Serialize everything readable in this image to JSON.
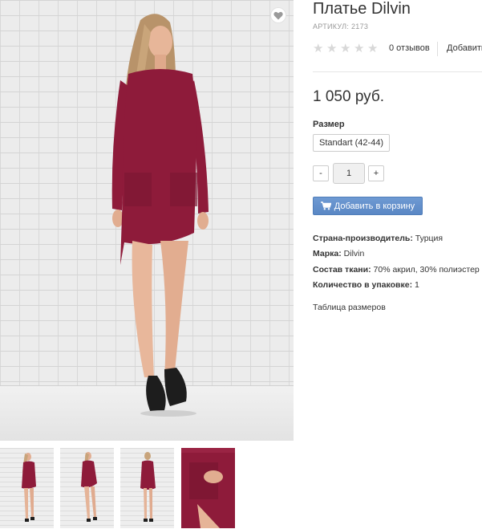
{
  "product": {
    "title": "Платье Dilvin",
    "sku_label": "АРТИКУЛ:",
    "sku_value": "2173",
    "reviews_link": "0 отзывов",
    "add_review_link": "Добавить отзыв",
    "price": "1 050 руб.",
    "size_label": "Размер",
    "size_option": "Standart (42-44)",
    "qty_minus": "-",
    "qty_value": "1",
    "qty_plus": "+",
    "add_to_cart": "Добавить в корзину",
    "size_table_link": "Таблица размеров"
  },
  "specs": [
    {
      "label": "Страна-производитель:",
      "value": "Турция"
    },
    {
      "label": "Марка:",
      "value": "Dilvin"
    },
    {
      "label": "Состав ткани:",
      "value": "70% акрил, 30% полиэстер"
    },
    {
      "label": "Количество в упаковке:",
      "value": "1"
    }
  ],
  "rating": {
    "stars_total": 5,
    "stars_filled": 0
  },
  "icons": {
    "wishlist": "heart-icon",
    "star": "star-icon",
    "cart": "cart-icon"
  },
  "colors": {
    "dress": "#8e1b3a",
    "cart_button": "#5a87c4",
    "star_empty": "#d8d8d8"
  }
}
